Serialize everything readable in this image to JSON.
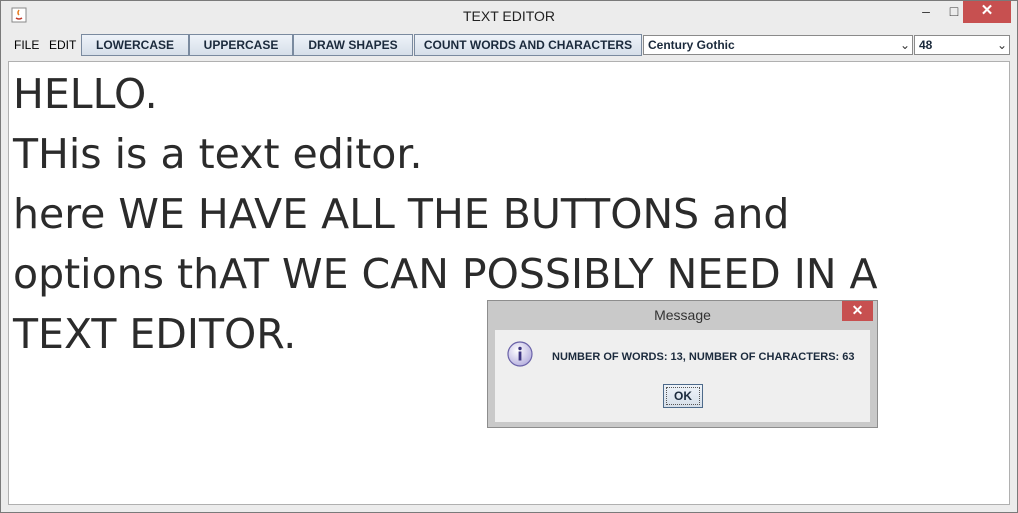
{
  "window": {
    "title": "TEXT EDITOR"
  },
  "menubar": {
    "file": "FILE",
    "edit": "EDIT"
  },
  "toolbar": {
    "lowercase": "LOWERCASE",
    "uppercase": "UPPERCASE",
    "draw_shapes": "DRAW SHAPES",
    "count": "COUNT WORDS AND CHARACTERS",
    "font_family": "Century Gothic",
    "font_size": "48"
  },
  "editor": {
    "lines": [
      "HELLO.",
      "THis is a text editor.",
      "here WE HAVE ALL THE BUTTONS and",
      "options thAT WE CAN POSSIBLY NEED IN A",
      "TEXT EDITOR."
    ]
  },
  "dialog": {
    "title": "Message",
    "message": "NUMBER OF WORDS: 13, NUMBER OF CHARACTERS: 63",
    "ok": "OK"
  },
  "icons": {
    "app": "java-icon",
    "info": "info-icon",
    "close": "close-icon"
  },
  "colors": {
    "close_red": "#c75050",
    "button_text": "#1b2a3c"
  }
}
